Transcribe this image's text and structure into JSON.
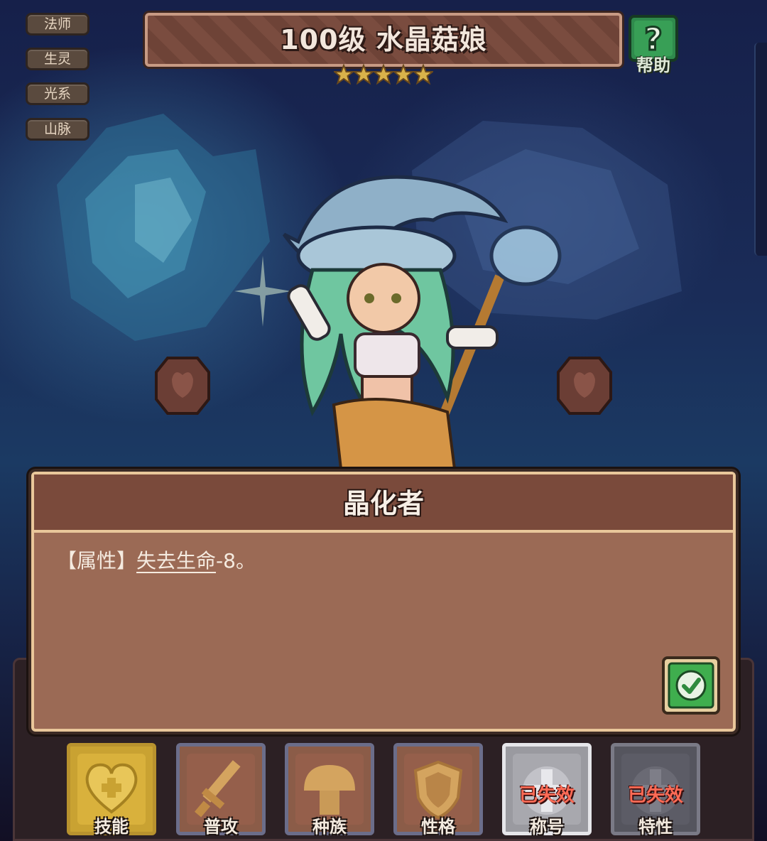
{
  "tags": [
    "法师",
    "生灵",
    "光系",
    "山脉"
  ],
  "header": {
    "title": "100级  水晶菇娘",
    "star_count": 5,
    "help_label": "帮助"
  },
  "dialog": {
    "title": "晶化者",
    "attr_prefix": "【属性】",
    "attr_link": "失去生命",
    "attr_value": "-8。"
  },
  "tabs": [
    {
      "label": "技能",
      "icon": "heart-emblem-icon",
      "status": ""
    },
    {
      "label": "普攻",
      "icon": "sword-icon",
      "status": ""
    },
    {
      "label": "种族",
      "icon": "mushroom-icon",
      "status": ""
    },
    {
      "label": "性格",
      "icon": "shield-icon",
      "status": ""
    },
    {
      "label": "称号",
      "icon": "cross-emblem-icon",
      "status": "已失效"
    },
    {
      "label": "特性",
      "icon": "cross-emblem-icon",
      "status": "已失效"
    }
  ],
  "colors": {
    "banner": "#7a4c3f",
    "dialog_body": "#9b6a55",
    "dialog_border": "#e9c79a",
    "invalid_status": "#ff6a55",
    "confirm": "#3fae4e"
  }
}
